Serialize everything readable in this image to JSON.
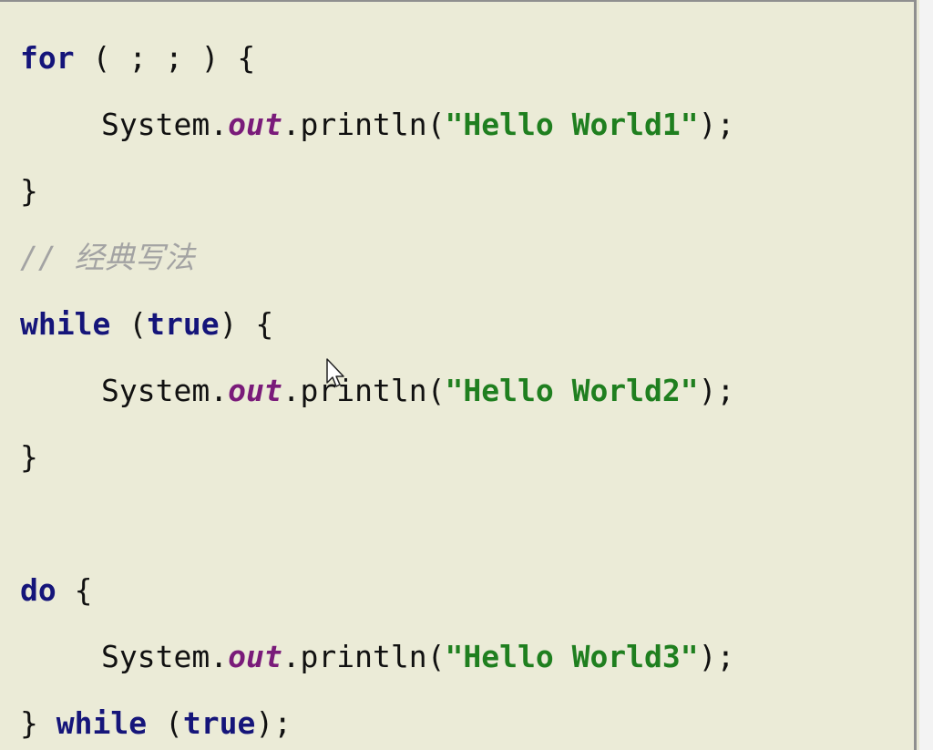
{
  "editor": {
    "lines": [
      {
        "id": "l1",
        "tokens": [
          {
            "t": "kw",
            "v": "for"
          },
          {
            "t": "p",
            "v": " ( ; ; ) {"
          }
        ]
      },
      {
        "id": "l2",
        "indent": true,
        "tokens": [
          {
            "t": "p",
            "v": "System."
          },
          {
            "t": "fld",
            "v": "out"
          },
          {
            "t": "p",
            "v": ".println("
          },
          {
            "t": "str",
            "v": "\"Hello World1\""
          },
          {
            "t": "p",
            "v": ");"
          }
        ]
      },
      {
        "id": "l3",
        "tokens": [
          {
            "t": "p",
            "v": "}"
          }
        ]
      },
      {
        "id": "l4",
        "tokens": [
          {
            "t": "cm",
            "v": "// 经典写法"
          }
        ]
      },
      {
        "id": "l5",
        "tokens": [
          {
            "t": "kw",
            "v": "while"
          },
          {
            "t": "p",
            "v": " ("
          },
          {
            "t": "kw",
            "v": "true"
          },
          {
            "t": "p",
            "v": ") {"
          }
        ]
      },
      {
        "id": "l6",
        "indent": true,
        "tokens": [
          {
            "t": "p",
            "v": "System."
          },
          {
            "t": "fld",
            "v": "out"
          },
          {
            "t": "p",
            "v": ".println("
          },
          {
            "t": "str",
            "v": "\"Hello World2\""
          },
          {
            "t": "p",
            "v": ");"
          }
        ]
      },
      {
        "id": "l7",
        "tokens": [
          {
            "t": "p",
            "v": "}"
          }
        ]
      },
      {
        "id": "l8",
        "tokens": [
          {
            "t": "kw",
            "v": "do"
          },
          {
            "t": "p",
            "v": " {"
          }
        ]
      },
      {
        "id": "l9",
        "indent": true,
        "tokens": [
          {
            "t": "p",
            "v": "System."
          },
          {
            "t": "fld",
            "v": "out"
          },
          {
            "t": "p",
            "v": ".println("
          },
          {
            "t": "str",
            "v": "\"Hello World3\""
          },
          {
            "t": "p",
            "v": ");"
          }
        ]
      },
      {
        "id": "l10",
        "tokens": [
          {
            "t": "p",
            "v": "} "
          },
          {
            "t": "kw",
            "v": "while"
          },
          {
            "t": "p",
            "v": " ("
          },
          {
            "t": "kw",
            "v": "true"
          },
          {
            "t": "p",
            "v": ");"
          }
        ]
      }
    ]
  },
  "colors": {
    "background": "#ebebd7",
    "keyword": "#15157a",
    "field": "#7a1b7a",
    "string": "#1f7f1f",
    "comment": "#a3a3a3"
  },
  "icons": {
    "cursor": "mouse-pointer-icon"
  }
}
